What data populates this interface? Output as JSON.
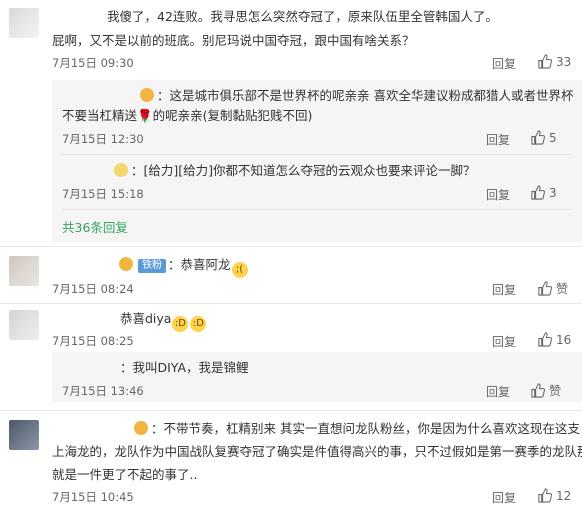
{
  "comments": [
    {
      "lines": [
        "我傻了，42连败。我寻思怎么突然夺冠了，原来队伍里全管韩国人了。",
        "屁啊，又不是以前的班底。别尼玛说中国夺冠，跟中国有啥关系？"
      ],
      "time": "7月15日 09:30",
      "reply": "回复",
      "likes": "33"
    },
    {
      "lines": [
        "：这是城市俱乐部不是世界杯的呢亲亲 喜欢全华建议粉成都猎人或者世界杯",
        "不要当杠精送🌹的呢亲亲(复制黏贴犯贱不回)"
      ],
      "time": "7月15日 12:30",
      "reply": "回复",
      "likes": "5"
    },
    {
      "lines": [
        "：[给力][给力]你都不知道怎么夺冠的云观众也要来评论一脚？"
      ],
      "time": "7月15日 15:18",
      "reply": "回复",
      "likes": "3"
    },
    {
      "badge": "铁粉",
      "text": "：恭喜阿龙",
      "emoji": "😭",
      "time": "7月15日 08:24",
      "reply": "回复",
      "likes": "赞"
    },
    {
      "text": "恭喜diya",
      "time": "7月15日 08:25",
      "reply": "回复",
      "likes": "16"
    },
    {
      "text": "：我叫DIYA，我是锦鲤",
      "time": "7月15日 13:46",
      "reply": "回复",
      "likes": "赞"
    },
    {
      "lines": [
        "：不带节奏，杠精别来 其实一直想问龙队粉丝，你是因为什么喜欢这现在这支",
        "上海龙的，龙队作为中国战队复赛夺冠了确实是件值得高兴的事，只不过假如是第一赛季的龙队那",
        "就是一件更了不起的事了.."
      ],
      "time": "7月15日 10:45",
      "reply": "回复",
      "likes": "12"
    }
  ],
  "more_link": "共36条回复"
}
